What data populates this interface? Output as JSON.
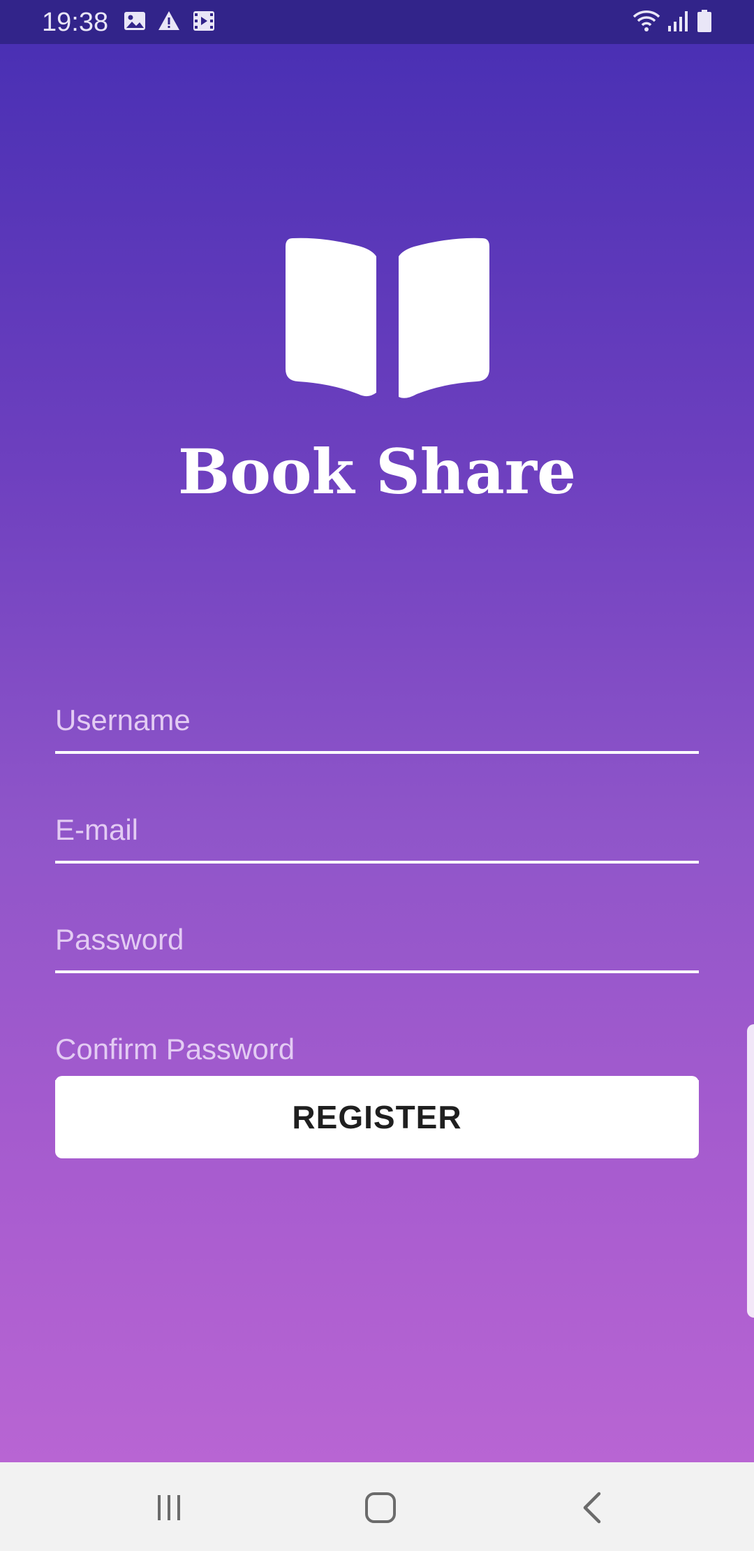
{
  "status_bar": {
    "time": "19:38",
    "icons": [
      "image-icon",
      "warning-icon",
      "video-icon",
      "wifi-icon",
      "signal-icon",
      "battery-icon"
    ]
  },
  "app": {
    "logo_icon": "open-book-icon",
    "title": "Book Share"
  },
  "form": {
    "username_placeholder": "Username",
    "email_placeholder": "E-mail",
    "password_placeholder": "Password",
    "confirm_password_placeholder": "Confirm Password",
    "register_label": "REGISTER"
  },
  "nav_bar": {
    "icons": [
      "recent-apps-icon",
      "home-icon",
      "back-icon"
    ]
  },
  "colors": {
    "status_bar": "#32248a",
    "gradient_top": "#4a30b4",
    "gradient_bottom": "#b865d3",
    "placeholder": "#e3cbf3",
    "button_bg": "#ffffff",
    "button_text": "#1f1f1f",
    "nav_bar": "#f2f2f2"
  }
}
